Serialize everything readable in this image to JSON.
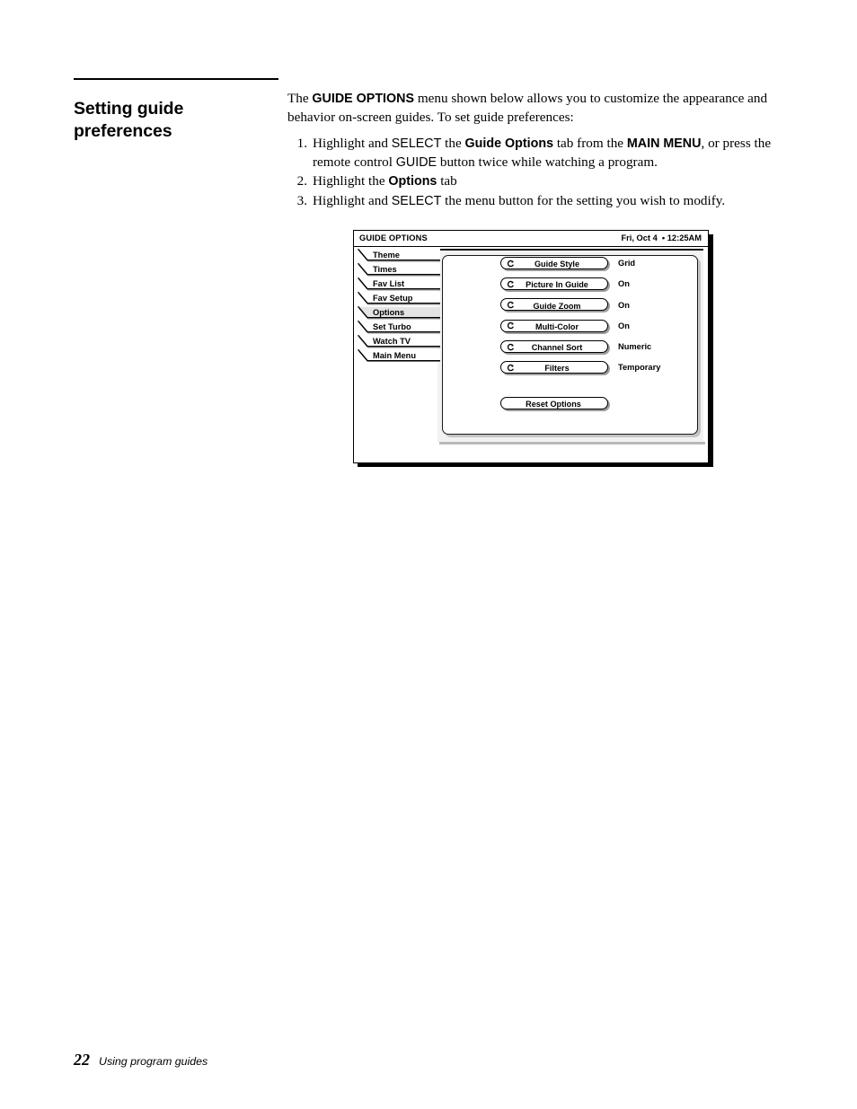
{
  "page": {
    "title_line1": "Setting guide",
    "title_line2": "preferences",
    "footer_page_number": "22",
    "footer_section": "Using program guides"
  },
  "body": {
    "intro_prefix": "The ",
    "intro_bold": "GUIDE OPTIONS",
    "intro_suffix": " menu shown below allows you to customize the appearance and behavior on-screen guides. To set guide preferences:",
    "steps": [
      {
        "number": "1.",
        "parts": [
          {
            "text": "Highlight and ",
            "style": "serif"
          },
          {
            "text": "SELECT",
            "style": "sans"
          },
          {
            "text": " the ",
            "style": "serif"
          },
          {
            "text": "Guide Options",
            "style": "sans-b"
          },
          {
            "text": " tab from the ",
            "style": "serif"
          },
          {
            "text": "MAIN MENU",
            "style": "sans-b"
          },
          {
            "text": ", or press the remote control ",
            "style": "serif"
          },
          {
            "text": "GUIDE",
            "style": "sans"
          },
          {
            "text": " button twice while watching a program.",
            "style": "serif"
          }
        ]
      },
      {
        "number": "2.",
        "parts": [
          {
            "text": "Highlight the ",
            "style": "serif"
          },
          {
            "text": "Options",
            "style": "sans-b"
          },
          {
            "text": " tab",
            "style": "serif"
          }
        ]
      },
      {
        "number": "3.",
        "parts": [
          {
            "text": "Highlight and ",
            "style": "serif"
          },
          {
            "text": "SELECT",
            "style": "sans"
          },
          {
            "text": " the menu button for the setting you wish to modify.",
            "style": "serif"
          }
        ]
      }
    ]
  },
  "tv_screen": {
    "header_title": "GUIDE OPTIONS",
    "header_clock": "Fri, Oct 4  • 12:25AM",
    "tabs": [
      {
        "label": "Theme",
        "selected": false
      },
      {
        "label": "Times",
        "selected": false
      },
      {
        "label": "Fav List",
        "selected": false
      },
      {
        "label": "Fav Setup",
        "selected": false
      },
      {
        "label": "Options",
        "selected": true
      },
      {
        "label": "Set Turbo",
        "selected": false
      },
      {
        "label": "Watch TV",
        "selected": false
      },
      {
        "label": "Main Menu",
        "selected": false
      }
    ],
    "options": [
      {
        "label": "Guide Style",
        "value": "Grid",
        "icon": "cycle-icon"
      },
      {
        "label": "Picture In Guide",
        "value": "On",
        "icon": "cycle-icon"
      },
      {
        "label": "Guide Zoom",
        "value": "On",
        "icon": "cycle-icon"
      },
      {
        "label": "Multi-Color",
        "value": "On",
        "icon": "cycle-icon"
      },
      {
        "label": "Channel Sort",
        "value": "Numeric",
        "icon": "cycle-icon"
      },
      {
        "label": "Filters",
        "value": "Temporary",
        "icon": "cycle-icon"
      }
    ],
    "reset_label": "Reset Options",
    "colors": {
      "frame": "#000000",
      "panel_bg": "#f2f2f2",
      "tab_selected_bg": "#e4e4e4",
      "tab_bg": "#ffffff",
      "shadow": "#9d9d9d"
    }
  }
}
